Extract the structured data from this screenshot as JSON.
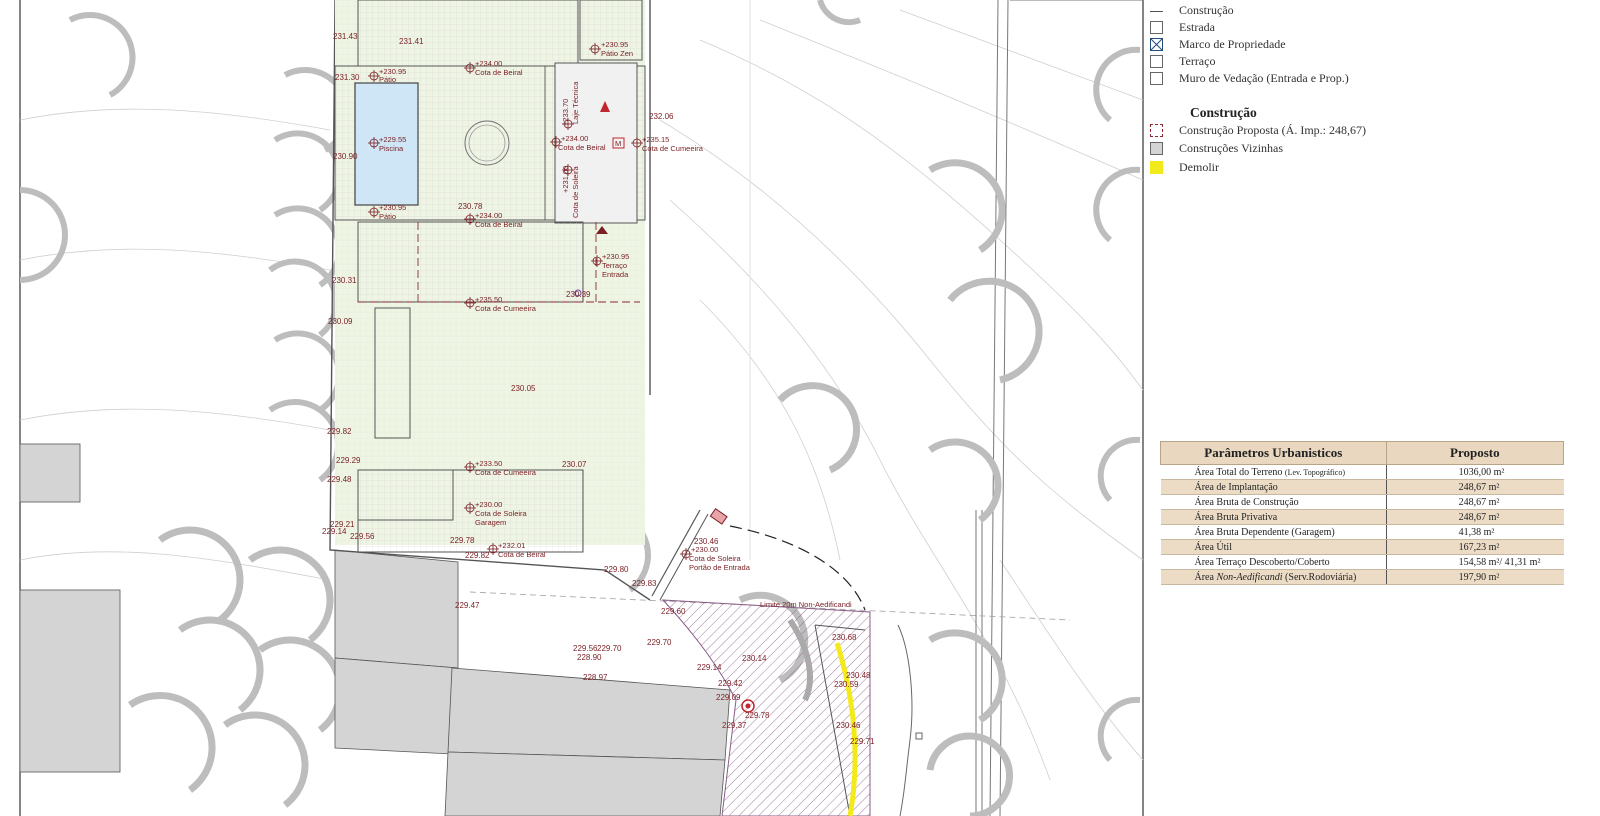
{
  "legend": {
    "items_top": [
      {
        "label": "Construção",
        "swatch": "line"
      },
      {
        "label": "Estrada",
        "swatch": "box"
      },
      {
        "label": "Marco de Propriedade",
        "swatch": "cross"
      },
      {
        "label": "Terraço",
        "swatch": "box"
      },
      {
        "label": "Muro de Vedação (Entrada e Prop.)",
        "swatch": "box"
      }
    ],
    "section_title": "Construção",
    "items_bottom": [
      {
        "label": "Construção Proposta (Á. Imp.: 248,67)",
        "swatch": "dashed"
      },
      {
        "label": "Construções Vizinhas",
        "swatch": "grey"
      },
      {
        "label": "Demolir",
        "swatch": "yellow"
      }
    ]
  },
  "colors": {
    "annotation": "#7a1f24",
    "pool": "#cfe6f7",
    "garden": "#eef5e3",
    "neighbour_building": "#d4d4d4",
    "demolish": "#f2ea1a",
    "table_header": "#e9d7bf",
    "hatch": "#8a5c86"
  },
  "table": {
    "headers": [
      "Parâmetros Urbanisticos",
      "Proposto"
    ],
    "rows": [
      {
        "label": "Área Total do Terreno",
        "note": "(Lev. Topográfico)",
        "value": "1036,00 m²"
      },
      {
        "label": "Área de Implantação",
        "value": "248,67 m²"
      },
      {
        "label": "Área Bruta de Construção",
        "value": "248,67 m²"
      },
      {
        "label": "Área Bruta Privativa",
        "value": "248,67 m²"
      },
      {
        "label": "Área Bruta Dependente (Garagem)",
        "value": "41,38 m²"
      },
      {
        "label": "Área Útil",
        "value": "167,23 m²"
      },
      {
        "label": "Área Terraço Descoberto/Coberto",
        "value": "154,58 m²/ 41,31 m²"
      },
      {
        "label_prefix": "Área ",
        "label_italic": "Non-Aedificandi",
        "label_suffix": " (Serv.Rodoviária)",
        "value": "197,90 m²"
      }
    ]
  },
  "plan": {
    "elevations": {
      "e1": "231.43",
      "e2": "231.41",
      "e3": "231.30",
      "e4": "230.90",
      "e5": "232.06",
      "e6": "230.78",
      "e7": "230.31",
      "e8": "230.39",
      "e9": "230.09",
      "e10": "230.05",
      "e11": "229.82",
      "e12": "229.29",
      "e13": "229.48",
      "e14": "230.07",
      "e15": "229.21",
      "e16": "229.14",
      "e17": "229.56",
      "e18": "229.78",
      "e19": "229.82",
      "e20": "230.46",
      "e21": "229.80",
      "e22": "229.83",
      "e23": "229.47",
      "e24": "229.60",
      "e25": "229.56",
      "e26": "229.70",
      "e27": "228.90",
      "e28": "229.70",
      "e29": "228.97",
      "e30": "229.14",
      "e31": "230.14",
      "e32": "230.68",
      "e33": "230.48",
      "e34": "230.59",
      "e35": "229.42",
      "e36": "229.09",
      "e37": "229.78",
      "e38": "229.37",
      "e39": "230.46",
      "e40": "229.71"
    },
    "markers": {
      "patio_zen": {
        "value": "+230.95",
        "name": "Pátio Zen"
      },
      "patio_top": {
        "value": "+230.95",
        "name": "Pátio"
      },
      "beiral_top": {
        "value": "+234.00",
        "name": "Cota de Beiral"
      },
      "laje": {
        "value": "+233.70",
        "name": "Laje Técnica"
      },
      "piscina": {
        "value": "+229.55",
        "name": "Piscina"
      },
      "beiral_mid": {
        "value": "+234.00",
        "name": "Cota de Beiral"
      },
      "cumeeira_right": {
        "value": "+235.15",
        "name": "Cota de Cumeeira"
      },
      "soleira_mid": {
        "value": "+231.00",
        "name": "Cota de Soleira"
      },
      "patio_low": {
        "value": "+230.95",
        "name": "Pátio"
      },
      "beiral_low": {
        "value": "+234.00",
        "name": "Cota de Beiral"
      },
      "terraco": {
        "value": "+230.95",
        "name": "Terraço",
        "name2": "Entrada"
      },
      "cumeeira_mid": {
        "value": "+235.50",
        "name": "Cota de Cumeeira"
      },
      "cumeeira_low": {
        "value": "+233.50",
        "name": "Cota de Cumeeira"
      },
      "garagem": {
        "value": "+230.00",
        "name": "Cota de Soleira",
        "name2": "Garagem"
      },
      "beiral_bottom": {
        "value": "+232.01",
        "name": "Cota de Beiral"
      },
      "portao": {
        "value": "+230.00",
        "name": "Cota de Soleira",
        "name2": "Portão de Entrada"
      }
    },
    "limit_label": "Limite 20m Non-Aedificandi",
    "meter_symbol": "M"
  }
}
